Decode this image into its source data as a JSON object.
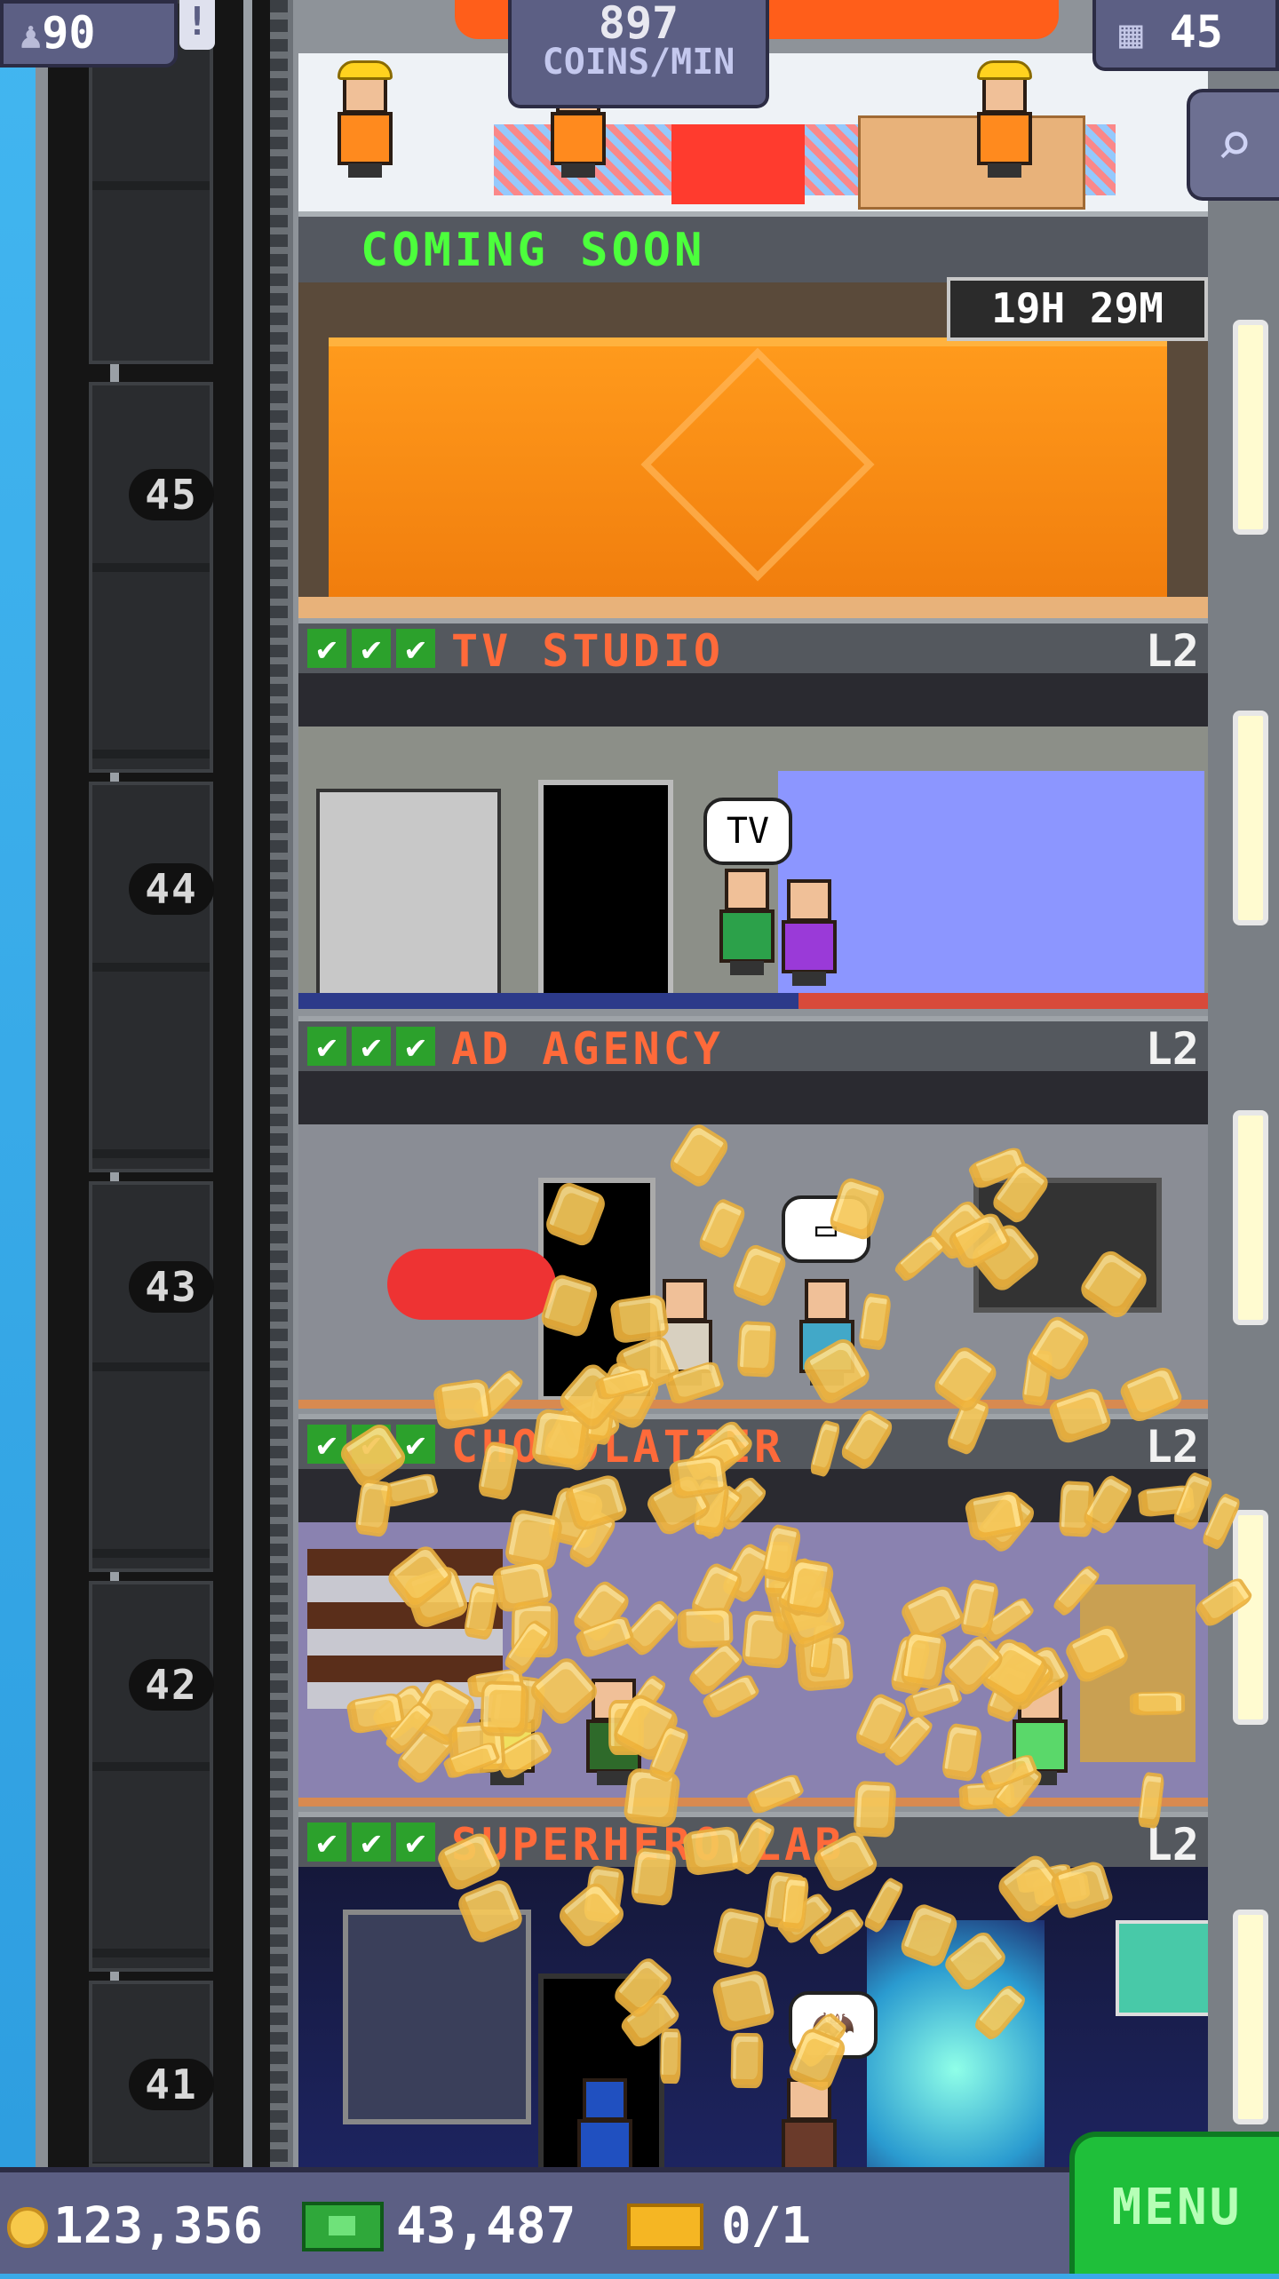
{
  "hud": {
    "population": "90",
    "alert_mark": "!",
    "coins_per_min_value": "897",
    "coins_per_min_unit": "COINS/MIN",
    "floor_count": "45"
  },
  "construction": {
    "label": "COMING SOON",
    "timer": "19H 29M"
  },
  "floors": [
    {
      "number": "45",
      "name": "",
      "level": ""
    },
    {
      "number": "44",
      "name": "TV STUDIO",
      "level": "L2",
      "checks": 3
    },
    {
      "number": "43",
      "name": "AD AGENCY",
      "level": "L2",
      "checks": 3
    },
    {
      "number": "42",
      "name": "CHOCOLATIER",
      "level": "L2",
      "checks": 3
    },
    {
      "number": "41",
      "name": "SUPERHERO LAB",
      "level": "L2",
      "checks": 3
    }
  ],
  "bubbles": {
    "tv": "TV",
    "ad": "▭",
    "hero": "🦇"
  },
  "bottom": {
    "coins": "123,356",
    "bux": "43,487",
    "tickets": "0/1",
    "menu_label": "MENU"
  },
  "icons": {
    "population": "person-icon",
    "floors": "building-icon",
    "search": "magnifier-icon",
    "coin": "coin-icon",
    "bux": "tower-bux-icon",
    "ticket": "vip-ticket-icon"
  },
  "colors": {
    "hud_bg": "#5c5f84",
    "floor_label": "#ff6a3a",
    "coming_soon": "#4cff3c",
    "menu": "#1fbf3a"
  }
}
